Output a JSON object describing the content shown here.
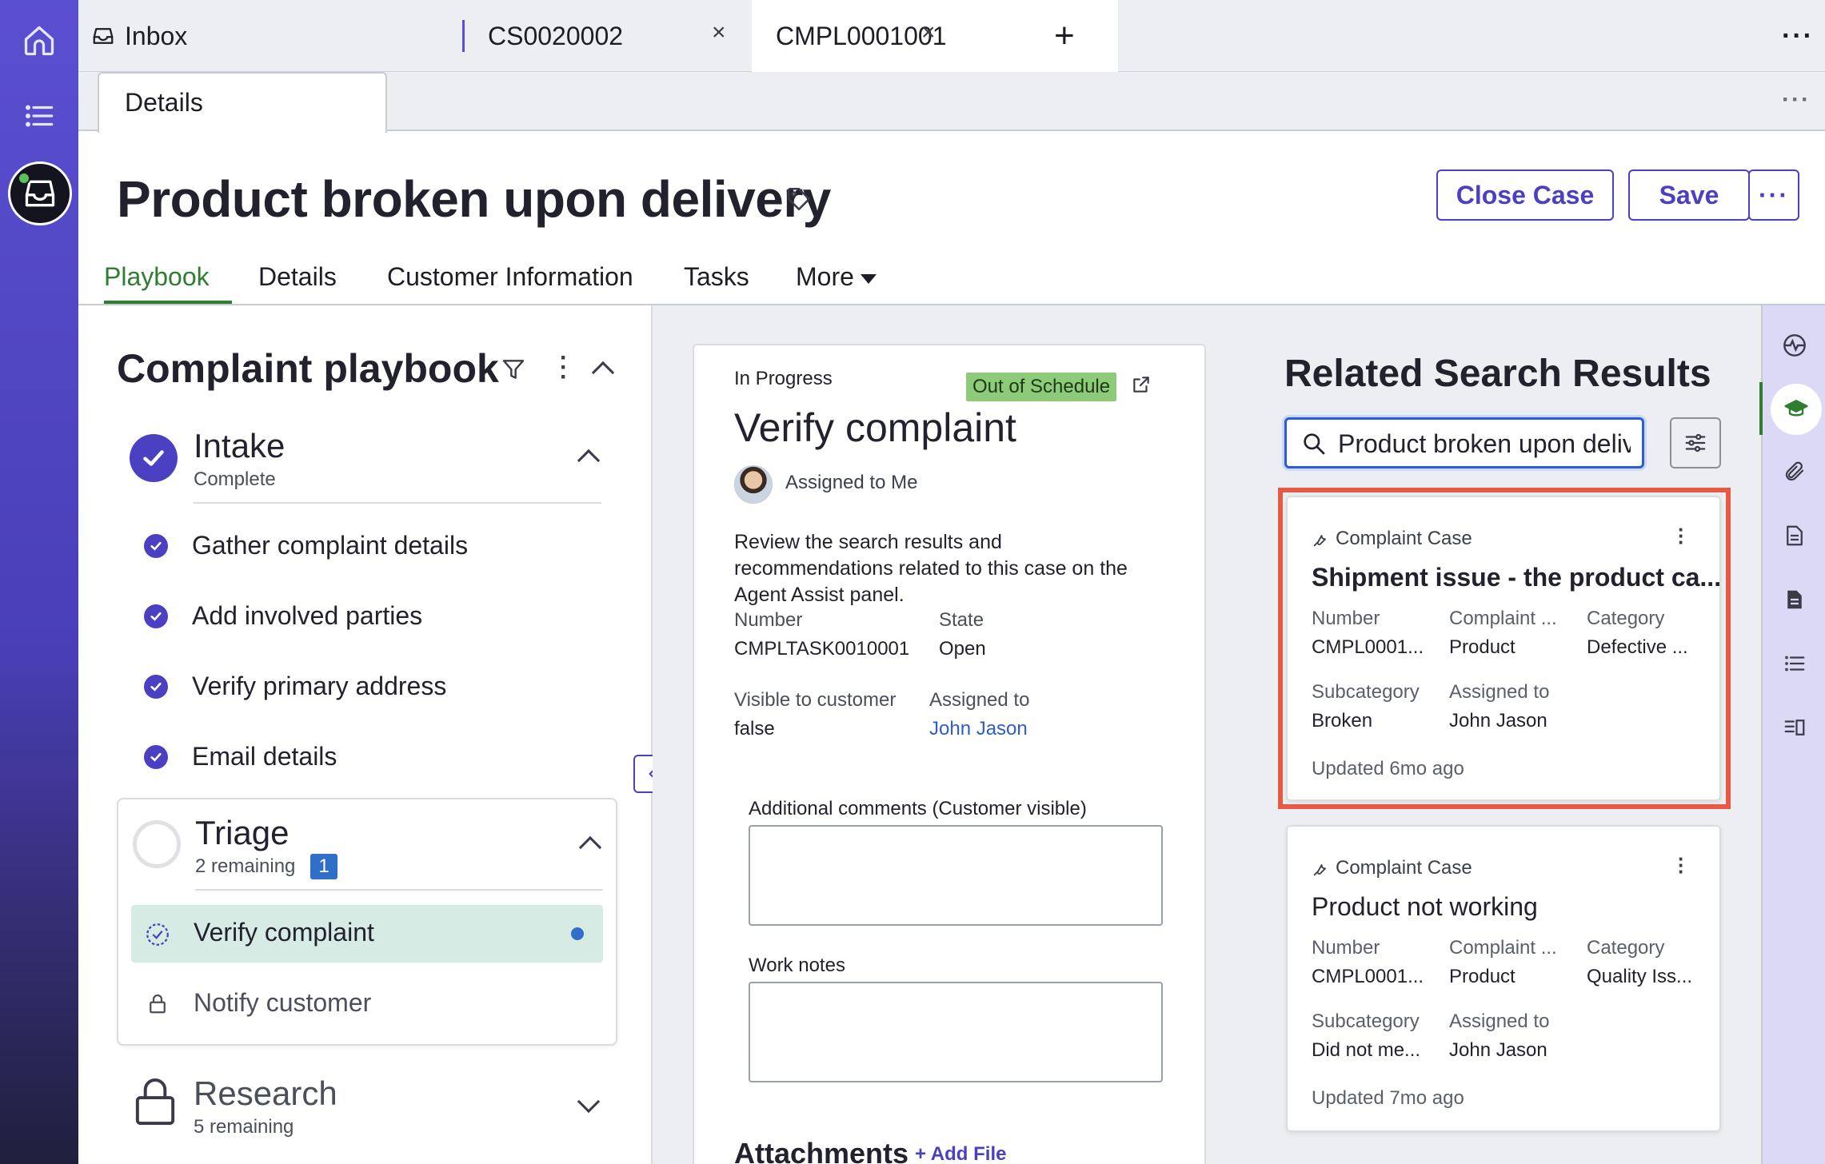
{
  "tabs": {
    "inbox": "Inbox",
    "case1": "CS0020002",
    "case2": "CMPL0001001",
    "close_symbol": "×",
    "add_symbol": "+",
    "more_symbol": "···"
  },
  "subtab": {
    "details": "Details",
    "more_symbol": "···"
  },
  "header": {
    "title": "Product broken upon delivery",
    "close_case": "Close Case",
    "save": "Save",
    "more_symbol": "···"
  },
  "main_tabs": {
    "playbook": "Playbook",
    "details": "Details",
    "customer_information": "Customer Information",
    "tasks": "Tasks",
    "more": "More"
  },
  "playbook": {
    "title": "Complaint playbook",
    "intake": {
      "title": "Intake",
      "status": "Complete",
      "tasks": [
        "Gather complaint details",
        "Add involved parties",
        "Verify primary address",
        "Email details"
      ]
    },
    "triage": {
      "title": "Triage",
      "status": "2 remaining",
      "badge": "1",
      "tasks": [
        "Verify complaint",
        "Notify customer"
      ]
    },
    "research": {
      "title": "Research",
      "status": "5 remaining"
    }
  },
  "task": {
    "status": "In Progress",
    "schedule_badge": "Out of Schedule",
    "title": "Verify complaint",
    "assigned": "Assigned to Me",
    "description": "Review the search results and recommendations related to this case on the Agent Assist panel.",
    "number_label": "Number",
    "number_value": "CMPLTASK0010001",
    "state_label": "State",
    "state_value": "Open",
    "visible_label": "Visible to customer",
    "visible_value": "false",
    "assigned_label": "Assigned to",
    "assigned_value": "John Jason",
    "comments_label": "Additional comments (Customer visible)",
    "work_notes_label": "Work notes",
    "attachments_label": "Attachments",
    "add_file": "+ Add File"
  },
  "related": {
    "title": "Related Search Results",
    "search_value": "Product broken upon delivery",
    "results": [
      {
        "type": "Complaint Case",
        "title": "Shipment issue - the product ca...",
        "number_label": "Number",
        "number_value": "CMPL0001...",
        "complaint_label": "Complaint ...",
        "complaint_value": "Product",
        "category_label": "Category",
        "category_value": "Defective ...",
        "subcategory_label": "Subcategory",
        "subcategory_value": "Broken",
        "assigned_label": "Assigned to",
        "assigned_value": "John Jason",
        "updated": "Updated 6mo ago"
      },
      {
        "type": "Complaint Case",
        "title": "Product not working",
        "number_label": "Number",
        "number_value": "CMPL0001...",
        "complaint_label": "Complaint ...",
        "complaint_value": "Product",
        "category_label": "Category",
        "category_value": "Quality Iss...",
        "subcategory_label": "Subcategory",
        "subcategory_value": "Did not me...",
        "assigned_label": "Assigned to",
        "assigned_value": "John Jason",
        "updated": "Updated 7mo ago"
      }
    ]
  },
  "colors": {
    "accent": "#4b40c2",
    "active_tab": "#2e7d32",
    "highlight_border": "#e65a45",
    "schedule_badge": "#8dca7a",
    "link": "#2f5bd0"
  }
}
